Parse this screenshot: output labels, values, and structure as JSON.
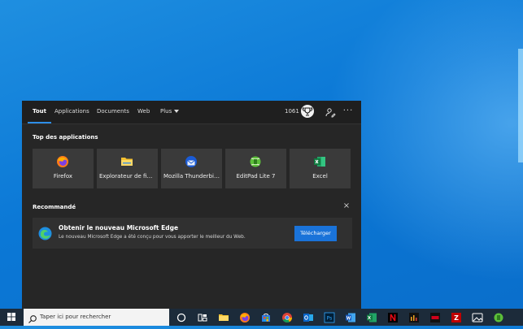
{
  "panel": {
    "tabs": [
      {
        "label": "Tout",
        "active": true
      },
      {
        "label": "Applications"
      },
      {
        "label": "Documents"
      },
      {
        "label": "Web"
      },
      {
        "label": "Plus"
      }
    ],
    "points": "1061",
    "more": "···",
    "top_apps_title": "Top des applications",
    "apps": [
      {
        "label": "Firefox",
        "icon": "firefox-icon"
      },
      {
        "label": "Explorateur de fichiers",
        "icon": "folder-icon"
      },
      {
        "label": "Mozilla Thunderbird",
        "icon": "thunderbird-icon"
      },
      {
        "label": "EditPad Lite 7",
        "icon": "editpad-icon"
      },
      {
        "label": "Excel",
        "icon": "excel-icon"
      }
    ],
    "recommended_title": "Recommandé",
    "close": "×",
    "recommendation": {
      "title": "Obtenir le nouveau Microsoft Edge",
      "description": "Le nouveau Microsoft Edge a été conçu pour vous apporter le meilleur du Web.",
      "button": "Télécharger"
    }
  },
  "taskbar": {
    "search_placeholder": "Taper ici pour rechercher",
    "pinned": [
      "task-view-icon",
      "file-explorer-icon",
      "firefox-icon",
      "store-icon",
      "chrome-icon",
      "outlook-icon",
      "photoshop-icon",
      "word-icon",
      "excel-icon",
      "netflix-icon",
      "audio-tool-icon",
      "red-app-icon",
      "filezilla-icon",
      "photos-icon",
      "green-app-icon"
    ]
  },
  "colors": {
    "accent": "#1a73d9",
    "panel_bg": "#262626",
    "tile_bg": "#3a3a3a",
    "taskbar_bg": "#1c2b3a"
  }
}
